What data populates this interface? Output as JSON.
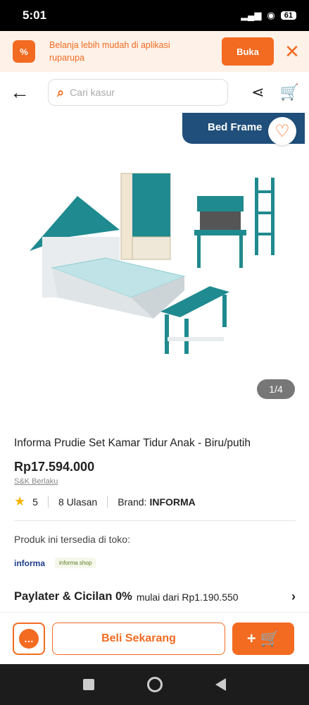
{
  "status": {
    "time": "5:01",
    "battery": "61",
    "wifi_glyph": "◉",
    "signal_glyph": "▂▄▆"
  },
  "banner": {
    "logo": "%",
    "text": "Belanja lebih mudah di aplikasi ruparupa",
    "button": "Buka",
    "close": "✕"
  },
  "header": {
    "back": "←",
    "search_placeholder": "Cari kasur",
    "search_glyph": "⌕",
    "share_glyph": "⋖",
    "cart_glyph": "🛒"
  },
  "gallery": {
    "category": "Bed Frame",
    "counter": "1/4",
    "heart_glyph": "♡"
  },
  "product": {
    "title": "Informa Prudie Set Kamar Tidur Anak - Biru/putih",
    "price": "Rp17.594.000",
    "terms": "S&K Berlaku",
    "rating": "5",
    "reviews": "8 Ulasan",
    "brand_label": "Brand: ",
    "brand": "INFORMA"
  },
  "stock": {
    "label": "Produk ini tersedia di toko:",
    "stores": [
      "informa",
      "informa shop"
    ]
  },
  "paylater": {
    "title": "Paylater & Cicilan 0%",
    "subtitle": "mulai dari Rp1.190.550"
  },
  "actions": {
    "chat_glyph": "…",
    "buy_now": "Beli Sekarang",
    "add_cart": "+ 🛒"
  },
  "colors": {
    "accent": "#f26b21",
    "badge": "#1f4f7a",
    "teal": "#1f8a8f"
  }
}
